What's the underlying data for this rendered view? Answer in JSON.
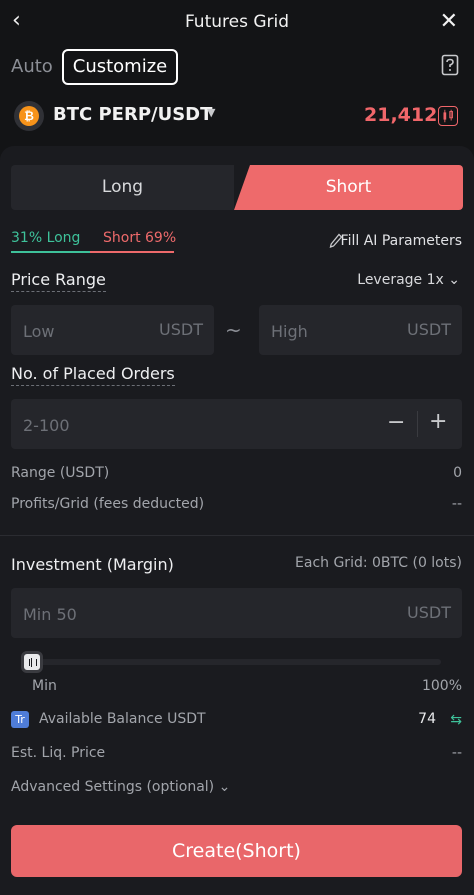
{
  "header": {
    "title": "Futures Grid",
    "back_glyph": "‹",
    "close_glyph": "✕"
  },
  "modes": {
    "auto": "Auto",
    "customize": "Customize"
  },
  "pair": {
    "coin_glyph": "₿",
    "name": "BTC PERP/USDT",
    "price": "21,412",
    "price_color": "#f0666a"
  },
  "direction": {
    "long": "Long",
    "short": "Short",
    "selected": "Short"
  },
  "ratio": {
    "long_label": "31% Long",
    "short_label": "Short 69%",
    "long_pct": 31,
    "short_pct": 69
  },
  "fill_ai": "Fill AI Parameters",
  "price_range": {
    "label": "Price Range",
    "leverage": "Leverage 1x",
    "low_placeholder": "Low",
    "high_placeholder": "High",
    "unit": "USDT",
    "separator": "~"
  },
  "orders": {
    "label": "No. of Placed Orders",
    "placeholder": "2-100",
    "minus": "−",
    "plus": "+"
  },
  "stats": {
    "range_label": "Range (USDT)",
    "range_value": "0",
    "profit_label": "Profits/Grid (fees deducted)",
    "profit_value": "--"
  },
  "investment": {
    "label": "Investment (Margin)",
    "each_grid": "Each Grid: 0BTC (0 lots)",
    "placeholder": "Min 50",
    "unit": "USDT",
    "slider_min": "Min",
    "slider_max": "100%",
    "slider_value": 0
  },
  "balance": {
    "badge": "Tr",
    "label": "Available Balance USDT",
    "value": "74",
    "swap_glyph": "⇆"
  },
  "liq": {
    "label": "Est. Liq. Price",
    "value": "--"
  },
  "advanced": "Advanced Settings (optional) ⌄",
  "create": "Create(Short)",
  "colors": {
    "accent_red": "#ee6a6b",
    "accent_green": "#3ec29a"
  }
}
